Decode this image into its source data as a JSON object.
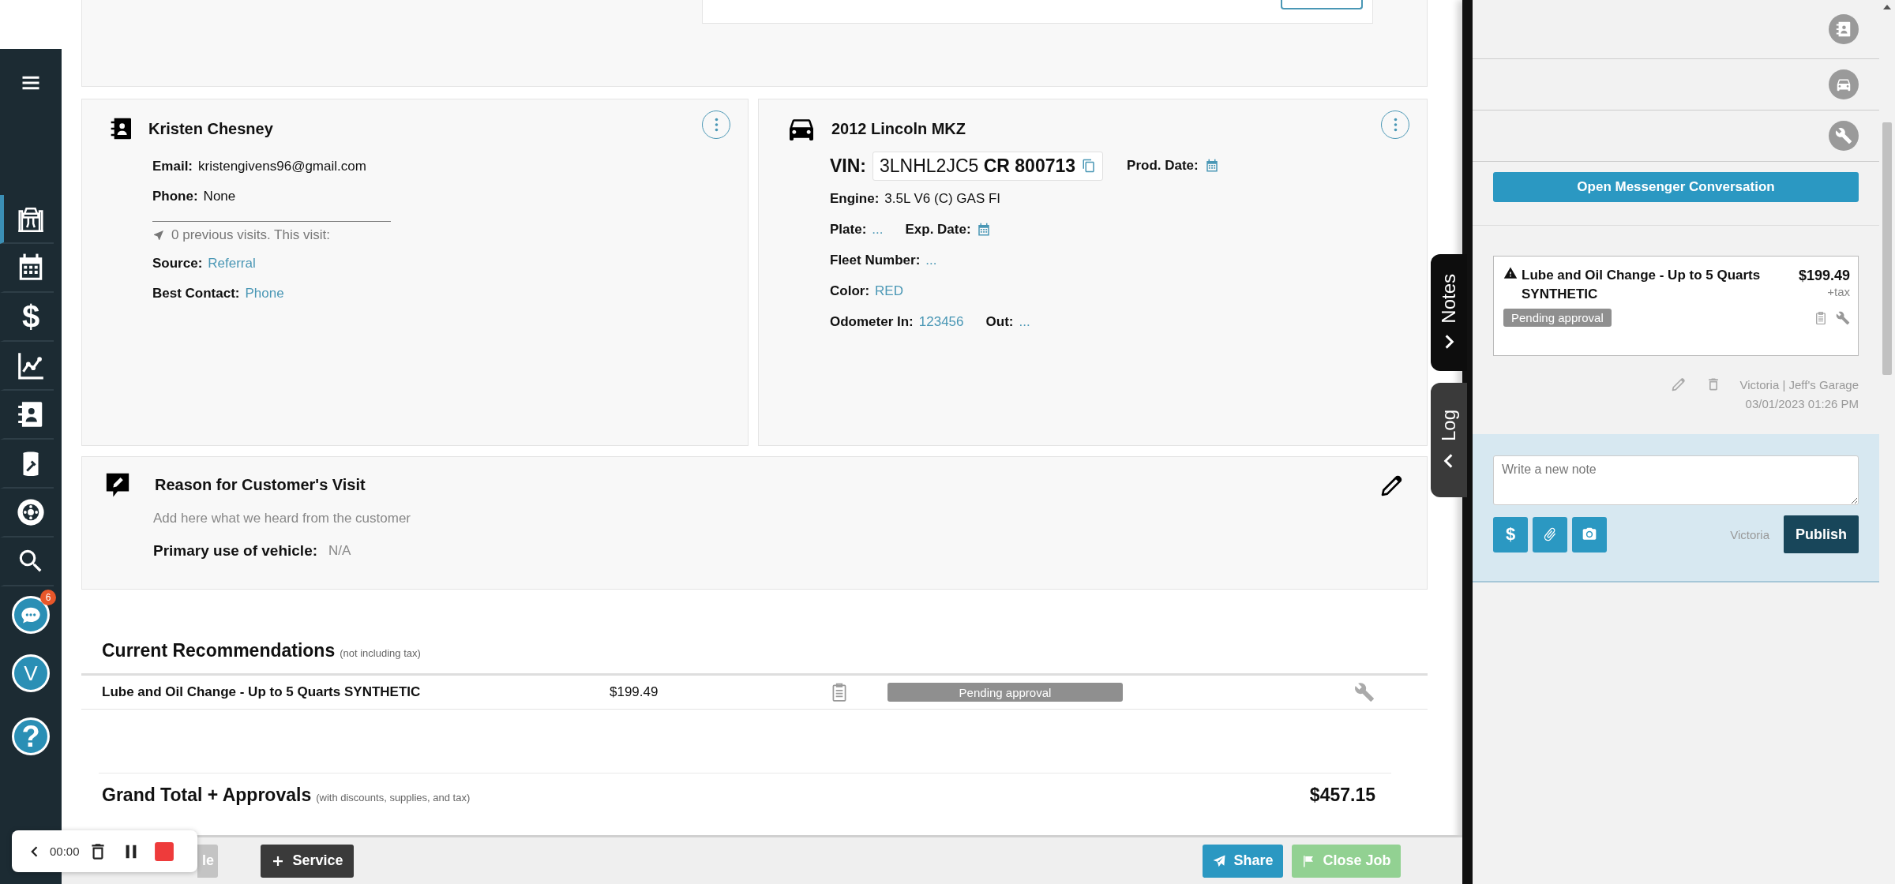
{
  "sidebar": {
    "items": [
      {
        "kind": "menu",
        "selected": false
      },
      {
        "kind": "lift",
        "selected": true
      },
      {
        "kind": "calendar",
        "selected": false
      },
      {
        "kind": "dollar",
        "label": "$",
        "selected": false
      },
      {
        "kind": "chart",
        "selected": false
      },
      {
        "kind": "contacts",
        "selected": false
      },
      {
        "kind": "oil",
        "selected": false
      },
      {
        "kind": "tire",
        "selected": false
      },
      {
        "kind": "search",
        "selected": false
      },
      {
        "kind": "chat",
        "badge": "6",
        "selected": false
      },
      {
        "kind": "avatar",
        "label": "V",
        "selected": false
      },
      {
        "kind": "help",
        "label": "?",
        "selected": false
      }
    ]
  },
  "customer": {
    "name": "Kristen Chesney",
    "fields": [
      {
        "label": "Email:",
        "value": "kristengivens96@gmail.com",
        "link": false
      },
      {
        "label": "Phone:",
        "value": "None",
        "link": false
      }
    ],
    "visits": "0 previous visits. This visit:",
    "visit_fields": [
      {
        "label": "Source:",
        "value": "Referral",
        "link": true
      },
      {
        "label": "Best Contact:",
        "value": "Phone",
        "link": true
      }
    ]
  },
  "vehicle": {
    "title": "2012 Lincoln MKZ",
    "vin_label": "VIN:",
    "vin": "3LNHL2JC5 **CR 800713**",
    "prod_date_label": "Prod. Date:",
    "rows": [
      [
        {
          "kind": "text",
          "label": "Engine:",
          "value": "3.5L V6 (C) GAS FI",
          "link": false
        }
      ],
      [
        {
          "kind": "text",
          "label": "Plate:",
          "value": "...",
          "link": true
        },
        {
          "kind": "date",
          "label": "Exp. Date:"
        }
      ],
      [
        {
          "kind": "text",
          "label": "Fleet Number:",
          "value": "...",
          "link": true
        }
      ],
      [
        {
          "kind": "text",
          "label": "Color:",
          "value": "RED",
          "link": true
        }
      ],
      [
        {
          "kind": "text",
          "label": "Odometer In:",
          "value": "123456",
          "link": true
        },
        {
          "kind": "text",
          "label": "Out:",
          "value": "...",
          "link": true
        }
      ]
    ]
  },
  "reason": {
    "title": "Reason for Customer's Visit",
    "hint": "Add here what we heard from the customer",
    "use_label": "Primary use of vehicle:",
    "use_value": "N/A"
  },
  "recommendations": {
    "title": "Current Recommendations",
    "note": "(not including tax)",
    "rows": [
      {
        "name": "Lube and Oil Change - Up to 5 Quarts SYNTHETIC",
        "price": "$199.49",
        "status": "Pending approval"
      }
    ]
  },
  "grand_total": {
    "title": "Grand Total + Approvals",
    "note": "(with discounts, supplies, and tax)",
    "amount": "$457.15"
  },
  "bottom_bar": {
    "buttons": [
      {
        "kind": "plain",
        "label": "le",
        "disabled": true
      },
      {
        "kind": "add",
        "label": "Service",
        "disabled": false
      },
      {
        "kind": "share",
        "label": "Share",
        "disabled": false
      },
      {
        "kind": "close",
        "label": "Close Job",
        "disabled": true
      }
    ]
  },
  "recorder": {
    "time": "00:00"
  },
  "side_tabs": [
    {
      "label": "Notes",
      "selected": true
    },
    {
      "label": "Log",
      "selected": false
    }
  ],
  "panel": {
    "shortcuts": [
      {
        "kind": "contacts"
      },
      {
        "kind": "car"
      },
      {
        "kind": "wrench"
      }
    ],
    "messenger_button": "Open Messenger Conversation",
    "note": {
      "title": "Lube and Oil Change - Up to 5 Quarts SYNTHETIC",
      "price": "$199.49",
      "tax": "+tax",
      "status": "Pending approval"
    },
    "author": "Victoria | Jeff's Garage",
    "date": "03/01/2023 01:26 PM",
    "composer": {
      "placeholder": "Write a new note",
      "tools": [
        {
          "kind": "dollar",
          "label": "$"
        },
        {
          "kind": "clip"
        },
        {
          "kind": "camera"
        }
      ],
      "author": "Victoria",
      "publish": "Publish"
    }
  }
}
